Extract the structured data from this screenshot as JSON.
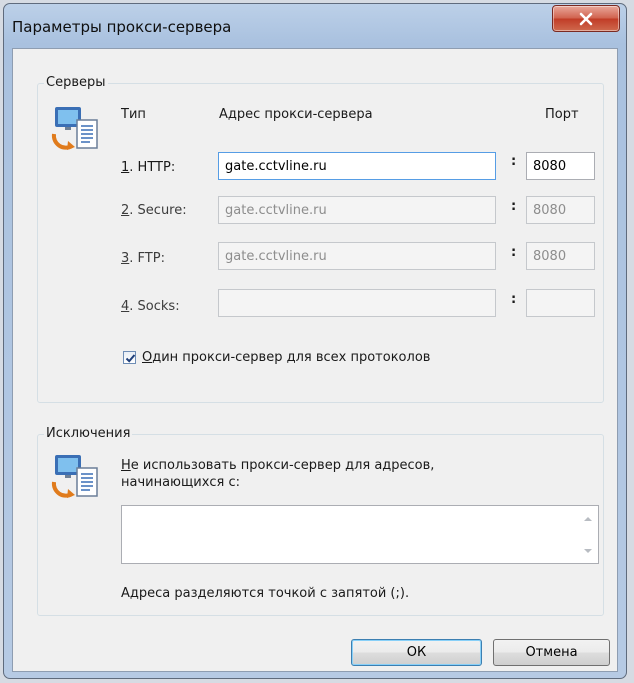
{
  "window": {
    "title": "Параметры прокси-сервера"
  },
  "servers": {
    "group_title": "Серверы",
    "col_type": "Тип",
    "col_address": "Адрес прокси-сервера",
    "col_port": "Порт",
    "rows": [
      {
        "key": "1",
        "rest": ". HTTP:",
        "address": "gate.cctvline.ru",
        "port": "8080",
        "enabled": true
      },
      {
        "key": "2",
        "rest": ". Secure:",
        "address": "gate.cctvline.ru",
        "port": "8080",
        "enabled": false
      },
      {
        "key": "3",
        "rest": ". FTP:",
        "address": "gate.cctvline.ru",
        "port": "8080",
        "enabled": false
      },
      {
        "key": "4",
        "rest": ". Socks:",
        "address": "",
        "port": "",
        "enabled": false
      }
    ],
    "same_proxy": {
      "key": "О",
      "rest": "дин прокси-сервер для всех протоколов",
      "checked": true
    }
  },
  "exceptions": {
    "group_title": "Исключения",
    "desc_key": "Н",
    "desc_rest_line1": "е использовать прокси-сервер для адресов,",
    "desc_line2": "начинающихся с:",
    "value": "",
    "hint": "Адреса разделяются точкой с запятой (;)."
  },
  "buttons": {
    "ok": "ОК",
    "cancel": "Отмена"
  },
  "icons": {
    "servers": "proxy-servers-icon",
    "exceptions": "proxy-exceptions-icon",
    "close": "close-icon"
  }
}
